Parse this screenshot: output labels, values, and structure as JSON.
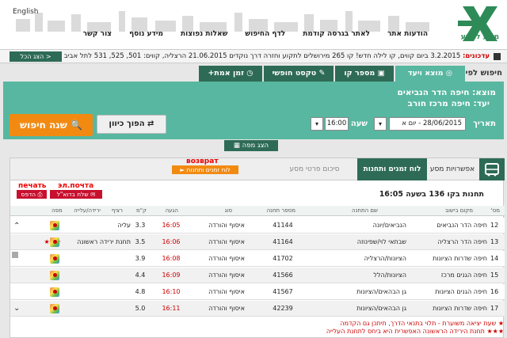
{
  "header": {
    "language": "English",
    "logo_text": "מידע לנוסע",
    "nav": [
      "הודעות אתר",
      "לאתר בגרסה קודמת",
      "לדף החיפוש",
      "שאלות נפוצות",
      "מידע נוסף",
      "צור קשר"
    ]
  },
  "updates": {
    "label": "עדכונים:",
    "date": "3.2.2015",
    "text": "ביום קווים, קו לילה חדש! קו 265 מירושלים לתקוע וחזרה דרך נוקדים 21.06.2015 הרצליה, קווים: 501, 525, 531 לתל אביב - ביטול",
    "show_all": "הצג הכל >"
  },
  "tabs": {
    "label": "חיפוש לפי",
    "items": [
      "מוצא ויעד",
      "מספר קו",
      "טקסט חופשי",
      "זמן אמת+"
    ]
  },
  "search": {
    "origin_label": "מוצא:",
    "origin_value": "חיפה הדר הנביאים",
    "dest_label": "יעד:",
    "dest_value": "חיפה מרכז חורב",
    "date_label": "תאריך",
    "date_value": "28/06/2015 - יום א",
    "hour_label": "שעה",
    "hour_value": "16:00",
    "swap_label": "הפוך כיוון",
    "search_label": "שנה חיפוש",
    "map_label": "הצג מפה"
  },
  "results": {
    "tab_options": "אפשרויות מסע",
    "tab_stations": "לוח זמנים ותחנות",
    "tab_summary": "סיכום פרטי מסע",
    "back_button": "לוח זמנים ותחנות",
    "back_tag": "возврат",
    "print_tag": "печать",
    "email_tag": "эл.почта",
    "print_button": "הדפס",
    "email_button": "שלח בדוא\"ל",
    "stops_title": "תחנות בקו 136 בשעה 16:05",
    "columns": {
      "stop": "מס'",
      "station": "מקום בישוב",
      "name": "שם התחנה",
      "code": "מספר תחנה",
      "type": "סוג",
      "arrival": "הגעה",
      "km": "ק\"מ",
      "platform": "רציף",
      "notes": "ירידה/עלייה",
      "map": "מפה"
    },
    "rows": [
      {
        "stop": "12",
        "station": "חיפה הדר הנביאים",
        "name": "הנביאים/יונה",
        "code": "41144",
        "type": "איסוף והורדה",
        "time": "16:05",
        "km": "3.3",
        "note": "עליה",
        "stars": ""
      },
      {
        "stop": "13",
        "station": "חיפה הדר הרצליה",
        "name": "שבתאי לוי/שפינוזה",
        "code": "41164",
        "type": "איסוף והורדה",
        "time": "16:06",
        "km": "3.5",
        "note": "תחנת ירידה ראשונה",
        "stars": "★★★"
      },
      {
        "stop": "14",
        "station": "חיפה שדרות הציונות",
        "name": "הציונות/הרצליה",
        "code": "41702",
        "type": "איסוף והורדה",
        "time": "16:08",
        "km": "3.9",
        "note": "",
        "stars": ""
      },
      {
        "stop": "15",
        "station": "חיפה הגנים מרכז",
        "name": "הציונות/הלל",
        "code": "41566",
        "type": "איסוף והורדה",
        "time": "16:09",
        "km": "4.4",
        "note": "",
        "stars": ""
      },
      {
        "stop": "16",
        "station": "חיפה הגנים הציונות",
        "name": "גן הבהאים/הציונות",
        "code": "41567",
        "type": "איסוף והורדה",
        "time": "16:10",
        "km": "4.8",
        "note": "",
        "stars": ""
      },
      {
        "stop": "17",
        "station": "חיפה שדרות הציונות",
        "name": "גן הבהאים/הציונות",
        "code": "42239",
        "type": "איסוף והורדה",
        "time": "16:11",
        "km": "5.0",
        "note": "",
        "stars": ""
      }
    ]
  },
  "legend": [
    "★ שעת יציאה משוערת - תלוי בתנאי הדרך, תיתכן גם הקדמה",
    "★★★ תחנת הירידה הראשונה האפשרית היא ביחס לתחנת העלייה"
  ],
  "colors": {
    "green_dark": "#2e6b56",
    "green_light": "#58b7a0",
    "orange": "#f28a12",
    "red": "#c8102e"
  }
}
